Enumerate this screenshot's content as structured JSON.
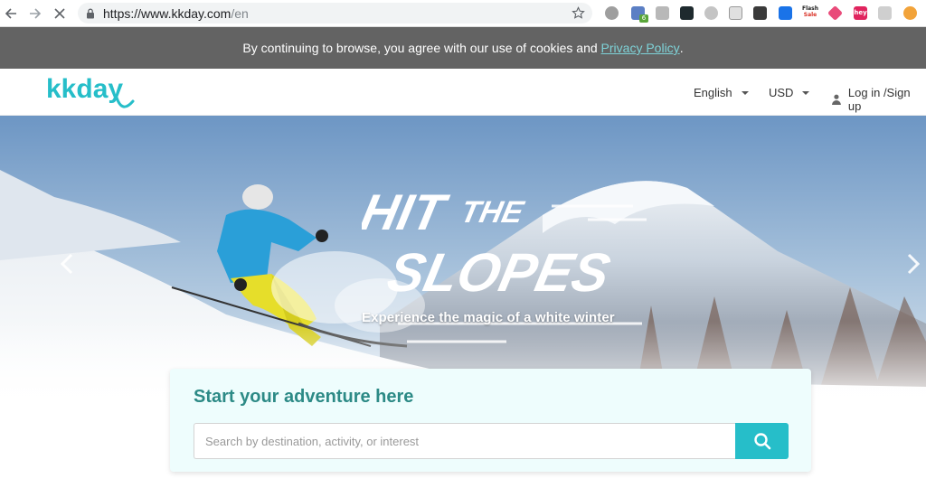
{
  "browser": {
    "url_host": "https://www.kkday.com",
    "url_path": "/en",
    "extension_badge": "6",
    "extension_flash_line1": "Flash",
    "extension_flash_line2": "Sale",
    "extension_hey": "hey",
    "icons": [
      "back-icon",
      "forward-icon",
      "stop-icon",
      "lock-icon",
      "star-icon"
    ]
  },
  "cookie_bar": {
    "text": "By continuing to browse, you agree with our use of cookies and ",
    "link": "Privacy Policy",
    "end": "."
  },
  "header": {
    "logo": "kkday",
    "language": "English",
    "currency": "USD",
    "login": "Log in /Sign up"
  },
  "hero": {
    "title_line1": "HIT",
    "title_line1b": "THE",
    "title_line2": "SLOPES",
    "tagline": "Experience the magic of a white winter"
  },
  "search": {
    "title": "Start your adventure here",
    "placeholder": "Search by destination, activity, or interest"
  },
  "colors": {
    "brand": "#26bec9",
    "title": "#2c8a86",
    "cookie_bg": "#636363",
    "link": "#7ed3d8"
  }
}
